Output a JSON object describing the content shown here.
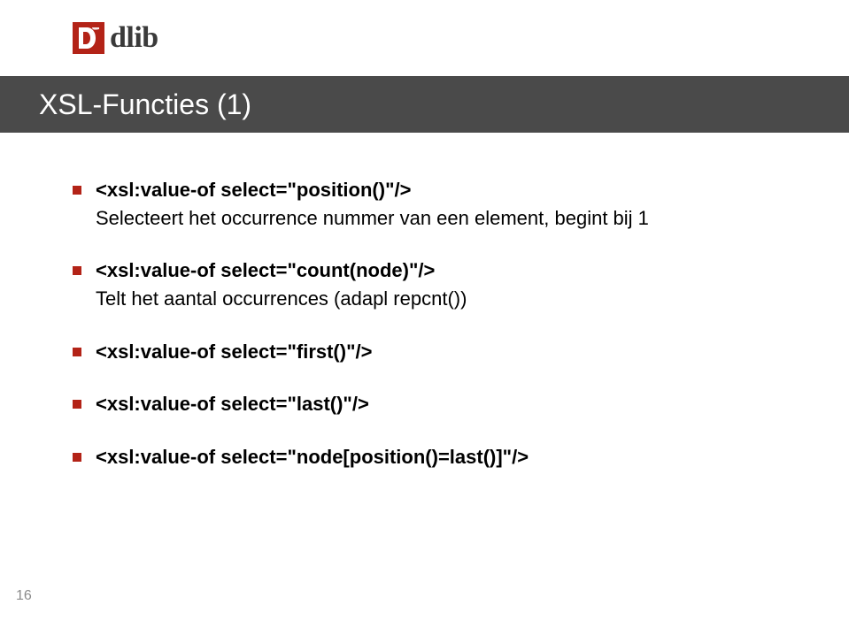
{
  "logo": {
    "brand_text": "dlib",
    "accent": "#b32317",
    "gray": "#3a3a3a"
  },
  "title": "XSL-Functies (1)",
  "bullets": [
    {
      "code": "<xsl:value-of select=\"position()\"/>",
      "desc": "Selecteert het occurrence nummer van een element, begint bij 1"
    },
    {
      "code": "<xsl:value-of select=\"count(node)\"/>",
      "desc": "Telt het aantal occurrences (adapl repcnt())"
    },
    {
      "code": "<xsl:value-of select=\"first()\"/>",
      "desc": ""
    },
    {
      "code": "<xsl:value-of select=\"last()\"/>",
      "desc": ""
    },
    {
      "code": "<xsl:value-of select=\"node[position()=last()]\"/>",
      "desc": ""
    }
  ],
  "page_number": "16"
}
